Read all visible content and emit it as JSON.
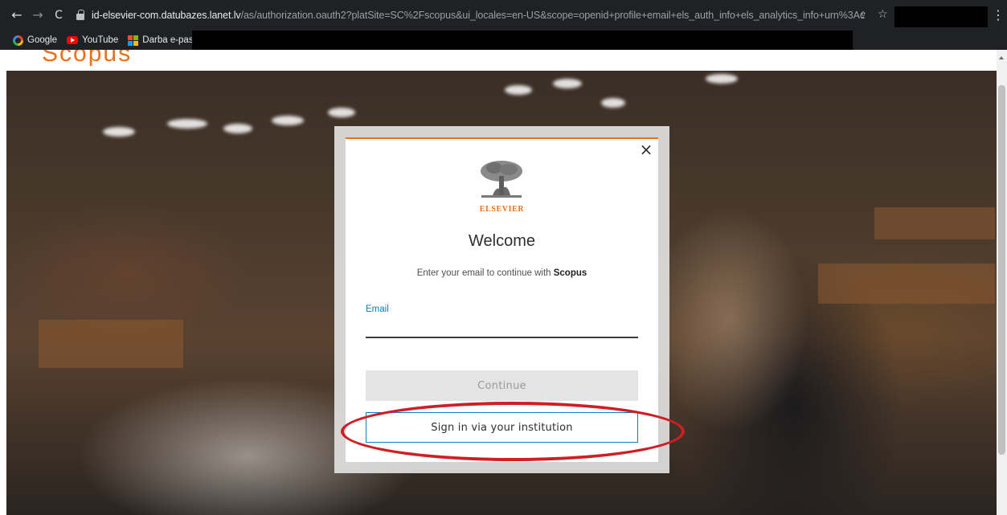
{
  "browser": {
    "url_host": "id-elsevier-com.datubazes.lanet.lv",
    "url_path": "/as/authorization.oauth2?platSite=SC%2Fscopus&ui_locales=en-US&scope=openid+profile+email+els_auth_info+els_analytics_info+urn%3Acom%3Ae...",
    "bookmarks": [
      {
        "label": "Google"
      },
      {
        "label": "YouTube"
      },
      {
        "label": "Darba e-pasts"
      }
    ]
  },
  "page": {
    "brand_partial": "Scopus"
  },
  "modal": {
    "close_label": "×",
    "logo_text": "ELSEVIER",
    "title": "Welcome",
    "subtitle_prefix": "Enter your email to continue with ",
    "subtitle_product": "Scopus",
    "email_label": "Email",
    "email_value": "",
    "continue_label": "Continue",
    "sso_label": "Sign in via your institution"
  },
  "colors": {
    "brand_orange": "#e9711c",
    "link_blue": "#0c7dbb",
    "highlight_red": "#d01f24",
    "disabled_gray": "#e4e4e4"
  },
  "icons": [
    "back-icon",
    "forward-icon",
    "reload-icon",
    "lock-icon",
    "share-icon",
    "star-icon",
    "menu-icon",
    "google-icon",
    "youtube-icon",
    "microsoft-icon",
    "close-icon",
    "elsevier-tree-icon"
  ]
}
